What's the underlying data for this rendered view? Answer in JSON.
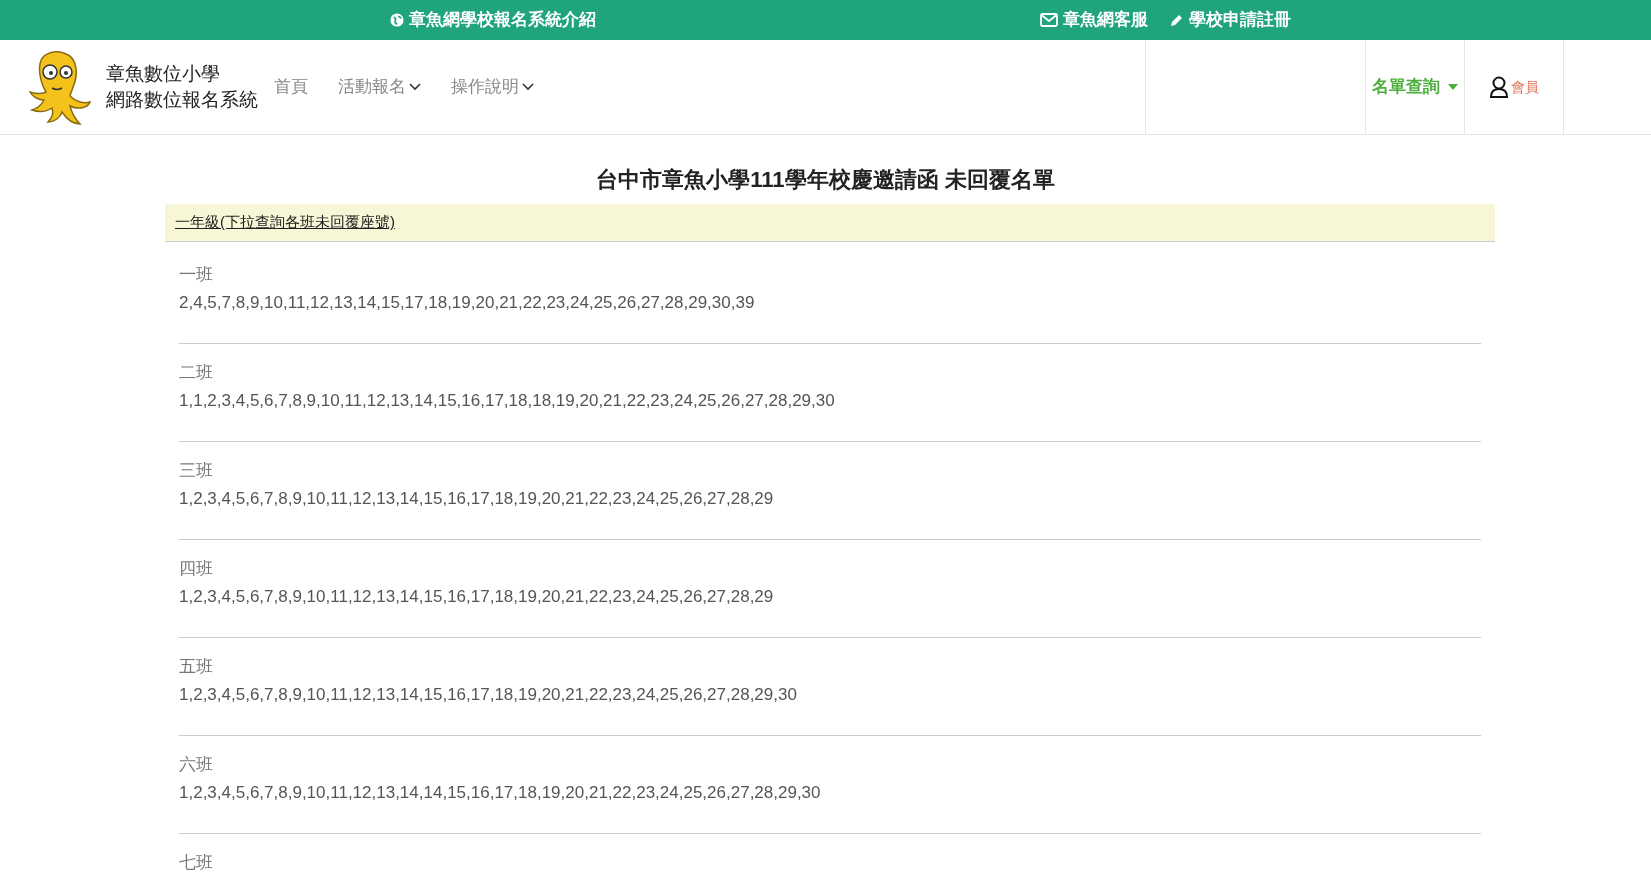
{
  "top_bar": {
    "links": [
      {
        "kind": "globe",
        "label": "章魚網學校報名系統介紹"
      },
      {
        "kind": "mail",
        "label": "章魚網客服"
      },
      {
        "kind": "pencil",
        "label": "學校申請註冊"
      }
    ]
  },
  "header": {
    "brand": [
      "章魚數位小學",
      "網路數位報名系統"
    ],
    "nav": [
      {
        "label": "首頁",
        "dropdown": false
      },
      {
        "label": "活動報名",
        "dropdown": true
      },
      {
        "label": "操作說明",
        "dropdown": true
      }
    ],
    "query_menu": {
      "label": "名單查詢"
    },
    "member": {
      "label": "會員"
    }
  },
  "page_title": "台中市章魚小學111學年校慶邀請函 未回覆名單",
  "grade_toggle": "一年級(下拉查詢各班未回覆座號)",
  "classes": [
    {
      "name": "一班",
      "seats": "2,4,5,7,8,9,10,11,12,13,14,15,17,18,19,20,21,22,23,24,25,26,27,28,29,30,39"
    },
    {
      "name": "二班",
      "seats": "1,1,2,3,4,5,6,7,8,9,10,11,12,13,14,15,16,17,18,18,19,20,21,22,23,24,25,26,27,28,29,30"
    },
    {
      "name": "三班",
      "seats": "1,2,3,4,5,6,7,8,9,10,11,12,13,14,15,16,17,18,19,20,21,22,23,24,25,26,27,28,29"
    },
    {
      "name": "四班",
      "seats": "1,2,3,4,5,6,7,8,9,10,11,12,13,14,15,16,17,18,19,20,21,22,23,24,25,26,27,28,29"
    },
    {
      "name": "五班",
      "seats": "1,2,3,4,5,6,7,8,9,10,11,12,13,14,15,16,17,18,19,20,21,22,23,24,25,26,27,28,29,30"
    },
    {
      "name": "六班",
      "seats": "1,2,3,4,5,6,7,8,9,10,11,12,13,14,14,15,16,17,18,19,20,21,22,23,24,25,26,27,28,29,30"
    },
    {
      "name": "七班"
    }
  ]
}
